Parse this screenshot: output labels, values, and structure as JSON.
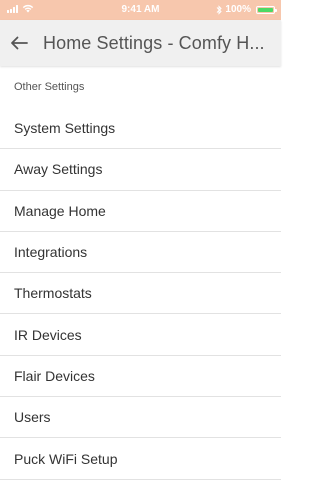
{
  "status_bar": {
    "time": "9:41 AM",
    "battery_percent": "100%",
    "battery_level": 1.0,
    "icons": [
      "signal-icon",
      "wifi-icon",
      "bluetooth-icon",
      "battery-icon"
    ]
  },
  "nav": {
    "title": "Home Settings - Comfy H...",
    "back_icon": "back-arrow-icon"
  },
  "section": {
    "header": "Other Settings"
  },
  "menu": {
    "items": [
      {
        "label": "System Settings"
      },
      {
        "label": "Away Settings"
      },
      {
        "label": "Manage Home"
      },
      {
        "label": "Integrations"
      },
      {
        "label": "Thermostats"
      },
      {
        "label": "IR Devices"
      },
      {
        "label": "Flair Devices"
      },
      {
        "label": "Users"
      },
      {
        "label": "Puck WiFi Setup"
      }
    ]
  },
  "colors": {
    "status_bar_bg": "#f7c7ad",
    "nav_bg": "#f0f0f0",
    "battery_fill": "#4cd964",
    "divider": "#e2e2e2"
  }
}
